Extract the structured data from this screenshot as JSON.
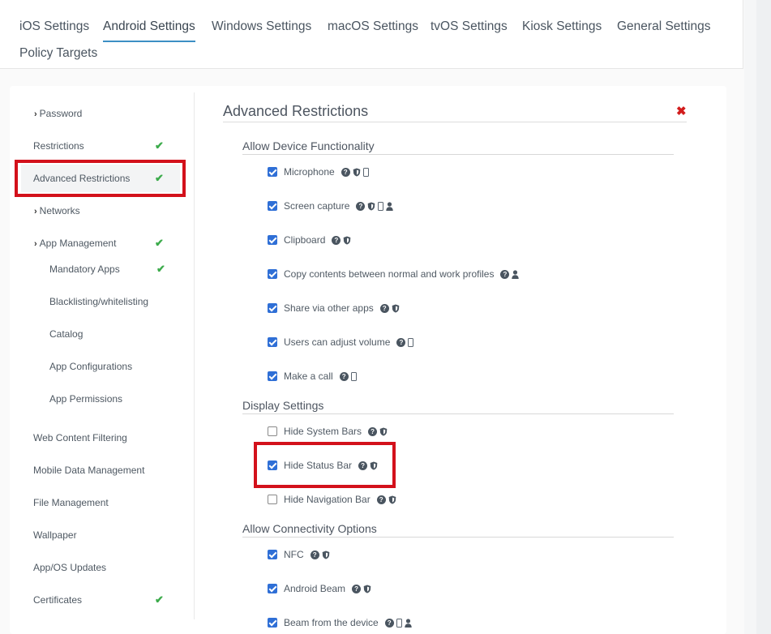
{
  "top_tabs": [
    {
      "label": "iOS Settings",
      "active": false
    },
    {
      "label": "Android Settings",
      "active": true
    },
    {
      "label": "Windows Settings",
      "active": false
    },
    {
      "label": "macOS Settings",
      "active": false
    },
    {
      "label": "tvOS Settings",
      "active": false
    },
    {
      "label": "Kiosk Settings",
      "active": false
    },
    {
      "label": "General Settings",
      "active": false
    },
    {
      "label": "Policy Targets",
      "active": false
    }
  ],
  "sidebar": {
    "items": [
      {
        "label": "Password",
        "expandable": true,
        "checked": false
      },
      {
        "label": "Restrictions",
        "expandable": false,
        "checked": true
      },
      {
        "label": "Advanced Restrictions",
        "expandable": false,
        "checked": true,
        "active": true
      },
      {
        "label": "Networks",
        "expandable": true,
        "checked": false
      },
      {
        "label": "App Management",
        "expandable": true,
        "checked": true
      },
      {
        "label": "Mandatory Apps",
        "sub": true,
        "checked": true
      },
      {
        "label": "Blacklisting/whitelisting",
        "sub": true,
        "checked": false
      },
      {
        "label": "Catalog",
        "sub": true,
        "checked": false
      },
      {
        "label": "App Configurations",
        "sub": true,
        "checked": false
      },
      {
        "label": "App Permissions",
        "sub": true,
        "checked": false
      },
      {
        "label": "Web Content Filtering",
        "checked": false
      },
      {
        "label": "Mobile Data Management",
        "checked": false
      },
      {
        "label": "File Management",
        "checked": false
      },
      {
        "label": "Wallpaper",
        "checked": false
      },
      {
        "label": "App/OS Updates",
        "checked": false
      },
      {
        "label": "Certificates",
        "checked": true
      }
    ]
  },
  "panel": {
    "title": "Advanced Restrictions",
    "close_icon": "close-icon",
    "sections": [
      {
        "title": "Allow Device Functionality",
        "options": [
          {
            "label": "Microphone",
            "checked": true,
            "icons": [
              "help-icon",
              "shield-icon",
              "phone-icon"
            ]
          },
          {
            "label": "Screen capture",
            "checked": true,
            "icons": [
              "help-icon",
              "shield-icon",
              "phone-icon",
              "person-icon"
            ]
          },
          {
            "label": "Clipboard",
            "checked": true,
            "icons": [
              "help-icon",
              "shield-icon"
            ]
          },
          {
            "label": "Copy contents between normal and work profiles",
            "checked": true,
            "icons": [
              "help-icon",
              "person-icon"
            ]
          },
          {
            "label": "Share via other apps",
            "checked": true,
            "icons": [
              "help-icon",
              "shield-icon"
            ]
          },
          {
            "label": "Users can adjust volume",
            "checked": true,
            "icons": [
              "help-icon",
              "phone-icon"
            ]
          },
          {
            "label": "Make a call",
            "checked": true,
            "icons": [
              "help-icon",
              "phone-icon"
            ]
          }
        ]
      },
      {
        "title": "Display Settings",
        "options": [
          {
            "label": "Hide System Bars",
            "checked": false,
            "icons": [
              "help-icon",
              "shield-icon"
            ]
          },
          {
            "label": "Hide Status Bar",
            "checked": true,
            "icons": [
              "help-icon",
              "shield-icon"
            ]
          },
          {
            "label": "Hide Navigation Bar",
            "checked": false,
            "icons": [
              "help-icon",
              "shield-icon"
            ]
          }
        ]
      },
      {
        "title": "Allow Connectivity Options",
        "options": [
          {
            "label": "NFC",
            "checked": true,
            "icons": [
              "help-icon",
              "shield-icon"
            ]
          },
          {
            "label": "Android Beam",
            "checked": true,
            "icons": [
              "help-icon",
              "shield-icon"
            ]
          },
          {
            "label": "Beam from the device",
            "checked": true,
            "icons": [
              "help-icon",
              "phone-icon",
              "person-icon"
            ]
          }
        ]
      }
    ]
  },
  "colors": {
    "accent": "#3c8fc4",
    "checkbox": "#2f6fd6",
    "check_mark": "#3cab4b",
    "highlight": "#d3111b",
    "close": "#d21c1c"
  }
}
